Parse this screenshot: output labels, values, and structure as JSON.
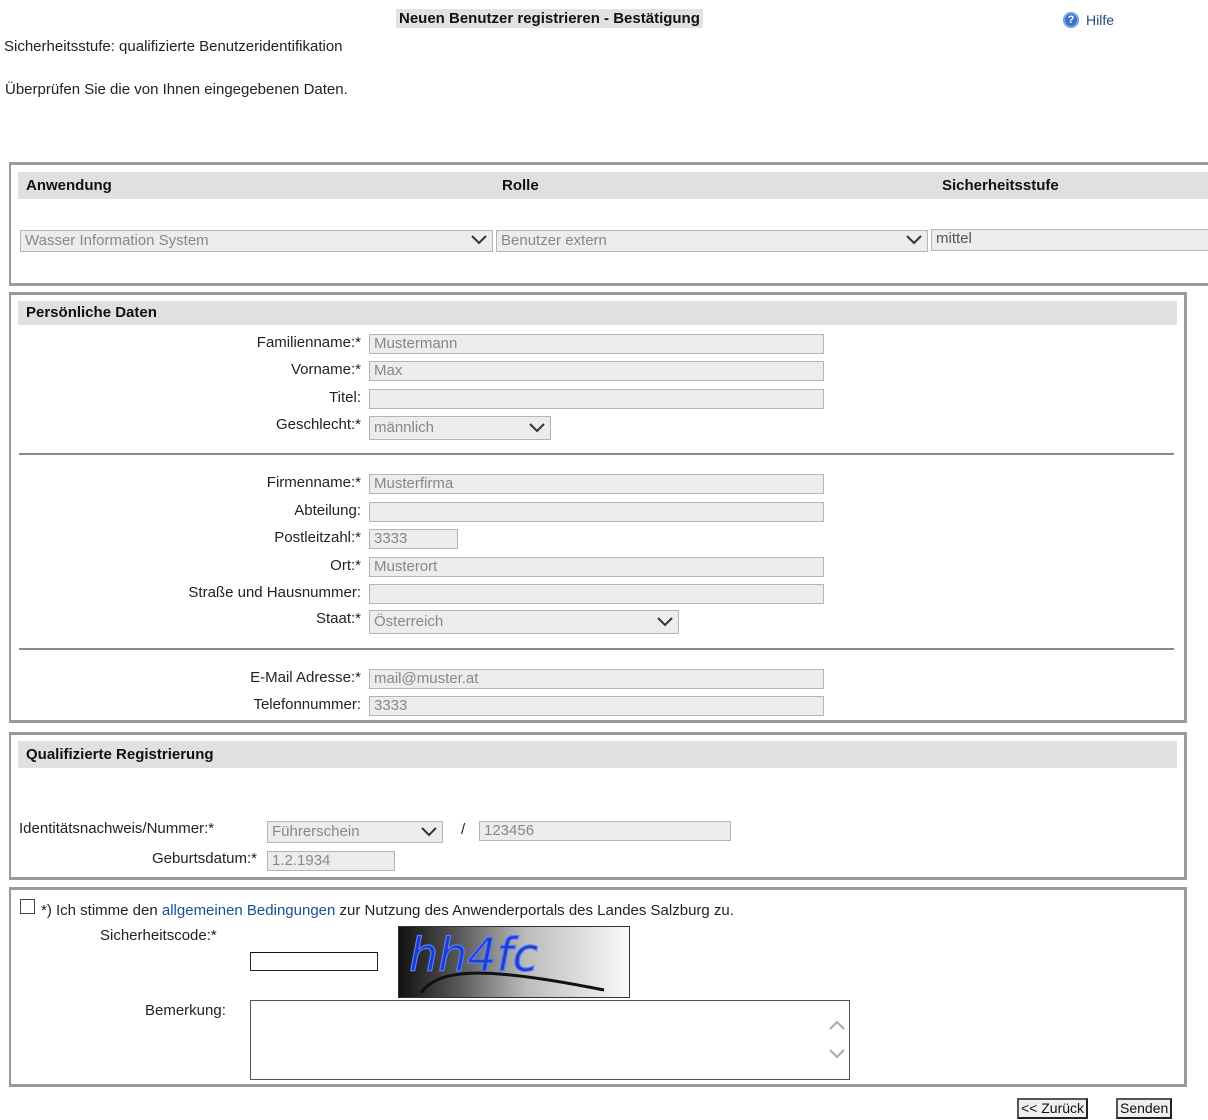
{
  "page": {
    "title": "Neuen Benutzer registrieren - Bestätigung",
    "help_label": "Hilfe",
    "security_level_text": "Sicherheitsstufe: qualifizierte Benutzeridentifikation",
    "review_text": "Überprüfen Sie die von Ihnen eingegebenen Daten."
  },
  "application": {
    "columns": [
      "Anwendung",
      "Rolle",
      "Sicherheitsstufe"
    ],
    "anwendung_value": "Wasser Information System",
    "rolle_value": "Benutzer extern",
    "sicherheitsstufe_value": "mittel"
  },
  "personal": {
    "header": "Persönliche Daten",
    "fields": {
      "familienname": {
        "label": "Familienname:*",
        "value": "Mustermann"
      },
      "vorname": {
        "label": "Vorname:*",
        "value": "Max"
      },
      "titel": {
        "label": "Titel:",
        "value": ""
      },
      "geschlecht": {
        "label": "Geschlecht:*",
        "value": "männlich"
      },
      "firmenname": {
        "label": "Firmenname:*",
        "value": "Musterfirma"
      },
      "abteilung": {
        "label": "Abteilung:",
        "value": ""
      },
      "postleitzahl": {
        "label": "Postleitzahl:*",
        "value": "3333"
      },
      "ort": {
        "label": "Ort:*",
        "value": "Musterort"
      },
      "strasse": {
        "label": "Straße und Hausnummer:",
        "value": ""
      },
      "staat": {
        "label": "Staat:*",
        "value": "Österreich"
      },
      "email": {
        "label": "E-Mail Adresse:*",
        "value": "mail@muster.at"
      },
      "telefon": {
        "label": "Telefonnummer:",
        "value": "3333"
      }
    }
  },
  "qualified": {
    "header": "Qualifizierte Registrierung",
    "id_label": "Identitätsnachweis/Nummer:*",
    "id_type": "Führerschein",
    "separator": "/",
    "id_number": "123456",
    "birth_label": "Geburtsdatum:*",
    "birth_value": "1.2.1934"
  },
  "consent": {
    "text_before": "*) Ich stimme den ",
    "link_text": "allgemeinen Bedingungen",
    "text_after": " zur Nutzung des Anwenderportals des Landes Salzburg zu.",
    "captcha_label": "Sicherheitscode:*",
    "captcha_text": "hh4fc",
    "remark_label": "Bemerkung:"
  },
  "buttons": {
    "back": "<< Zurück",
    "send": "Senden"
  },
  "colors": {
    "header_bg": "#e0e0e0",
    "field_bg": "#ececec",
    "link": "#1a4d99"
  }
}
